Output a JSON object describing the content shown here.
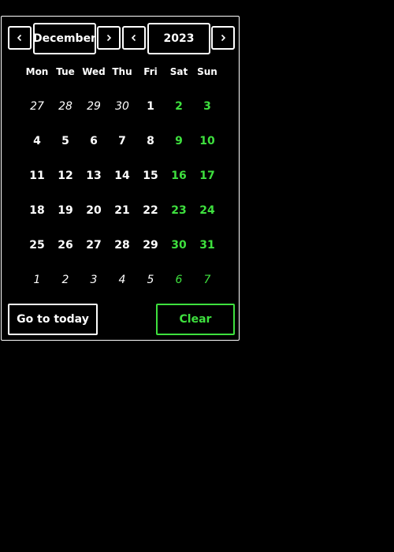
{
  "header": {
    "month": "December",
    "year": "2023",
    "prev_month_icon": "chevron-left-icon",
    "next_month_icon": "chevron-right-icon",
    "prev_year_icon": "chevron-left-icon",
    "next_year_icon": "chevron-right-icon"
  },
  "weekdays": [
    "Mon",
    "Tue",
    "Wed",
    "Thu",
    "Fri",
    "Sat",
    "Sun"
  ],
  "weeks": [
    [
      {
        "label": "27",
        "outside": true
      },
      {
        "label": "28",
        "outside": true
      },
      {
        "label": "29",
        "outside": true
      },
      {
        "label": "30",
        "outside": true
      },
      {
        "label": "1"
      },
      {
        "label": "2",
        "weekend": true
      },
      {
        "label": "3",
        "weekend": true
      }
    ],
    [
      {
        "label": "4"
      },
      {
        "label": "5"
      },
      {
        "label": "6"
      },
      {
        "label": "7"
      },
      {
        "label": "8"
      },
      {
        "label": "9",
        "weekend": true
      },
      {
        "label": "10",
        "weekend": true
      }
    ],
    [
      {
        "label": "11"
      },
      {
        "label": "12"
      },
      {
        "label": "13"
      },
      {
        "label": "14"
      },
      {
        "label": "15"
      },
      {
        "label": "16",
        "weekend": true
      },
      {
        "label": "17",
        "weekend": true
      }
    ],
    [
      {
        "label": "18"
      },
      {
        "label": "19"
      },
      {
        "label": "20"
      },
      {
        "label": "21"
      },
      {
        "label": "22"
      },
      {
        "label": "23",
        "weekend": true
      },
      {
        "label": "24",
        "weekend": true
      }
    ],
    [
      {
        "label": "25"
      },
      {
        "label": "26"
      },
      {
        "label": "27"
      },
      {
        "label": "28"
      },
      {
        "label": "29"
      },
      {
        "label": "30",
        "weekend": true
      },
      {
        "label": "31",
        "weekend": true
      }
    ],
    [
      {
        "label": "1",
        "outside": true
      },
      {
        "label": "2",
        "outside": true
      },
      {
        "label": "3",
        "outside": true
      },
      {
        "label": "4",
        "outside": true
      },
      {
        "label": "5",
        "outside": true
      },
      {
        "label": "6",
        "outside": true,
        "weekend": true
      },
      {
        "label": "7",
        "outside": true,
        "weekend": true
      }
    ]
  ],
  "footer": {
    "today_label": "Go to today",
    "clear_label": "Clear"
  },
  "colors": {
    "background": "#000000",
    "text": "#ffffff",
    "weekend_accent": "#3ee03e"
  }
}
